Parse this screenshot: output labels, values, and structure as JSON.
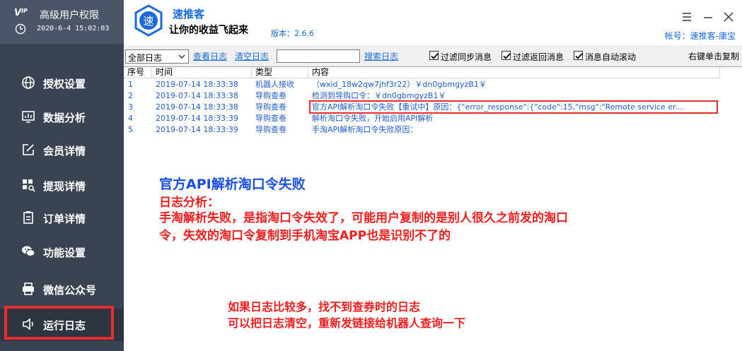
{
  "sidebar": {
    "role": "高级用户权限",
    "datetime": "2020-6-4 15:02:03",
    "items": [
      {
        "label": "授权设置",
        "icon": "globe-icon"
      },
      {
        "label": "数据分析",
        "icon": "chart-icon"
      },
      {
        "label": "会员详情",
        "icon": "edit-icon"
      },
      {
        "label": "提现详情",
        "icon": "search-grid-icon"
      },
      {
        "label": "订单详情",
        "icon": "clipboard-icon"
      },
      {
        "label": "功能设置",
        "icon": "chat-bubble-icon"
      },
      {
        "label": "微信公众号",
        "icon": "printer-icon"
      },
      {
        "label": "运行日志",
        "icon": "speaker-icon",
        "active": true
      }
    ]
  },
  "header": {
    "logo_char": "速",
    "app_name": "速推客",
    "slogan": "让你的收益飞起来",
    "version": "版本：2.6.6",
    "account": "帐号：速推客-康宝"
  },
  "toolbar": {
    "filter_value": "全部日志",
    "view_log": "查看日志",
    "clear_log": "清空日志",
    "search_value": "",
    "search_log": "搜索日志",
    "chk_sync": "过滤同步消息",
    "chk_return": "过滤返回消息",
    "chk_scroll": "消息自动滚动",
    "copy_hint": "右键单击复制"
  },
  "log": {
    "columns": [
      "序号",
      "时间",
      "类型",
      "内容"
    ],
    "rows": [
      {
        "no": "1",
        "time": "2019-07-14 18:33:38",
        "type": "机器人接收",
        "content": "（wxid_18w2qw7jhf3r22）￥dn0gbmgyzB1￥"
      },
      {
        "no": "2",
        "time": "2019-07-14 18:33:38",
        "type": "导购查卷",
        "content": "检测到导购口令：￥dn0gbmgyzB1￥"
      },
      {
        "no": "3",
        "time": "2019-07-14 18:33:38",
        "type": "导购查卷",
        "content": "官方API解析淘口令失败【重试中】原因：{\"error_response\":{\"code\":15,\"msg\":\"Remote service er..."
      },
      {
        "no": "4",
        "time": "2019-07-14 18:33:39",
        "type": "导购查卷",
        "content": "解析淘口令失败，开始启用API解析"
      },
      {
        "no": "5",
        "time": "2019-07-14 18:33:39",
        "type": "导购查卷",
        "content": "手淘API解析淘口令失败原因："
      }
    ]
  },
  "annotations": {
    "title": "官方API解析淘口令失败",
    "analysis_label": "日志分析：",
    "analysis_line1": "手淘解析失败，是指淘口令失效了，可能用户复制的是别人很久之前发的淘口",
    "analysis_line2": "令，失效的淘口令复制到手机淘宝APP也是识别不了的",
    "tip_line1": "如果日志比较多，找不到查券时的日志",
    "tip_line2": "可以把日志清空，重新发链接给机器人查询一下"
  },
  "colors": {
    "sidebar_bg": "#394352",
    "accent_blue": "#1a6bd6",
    "highlight_red": "#ef2b2b"
  }
}
